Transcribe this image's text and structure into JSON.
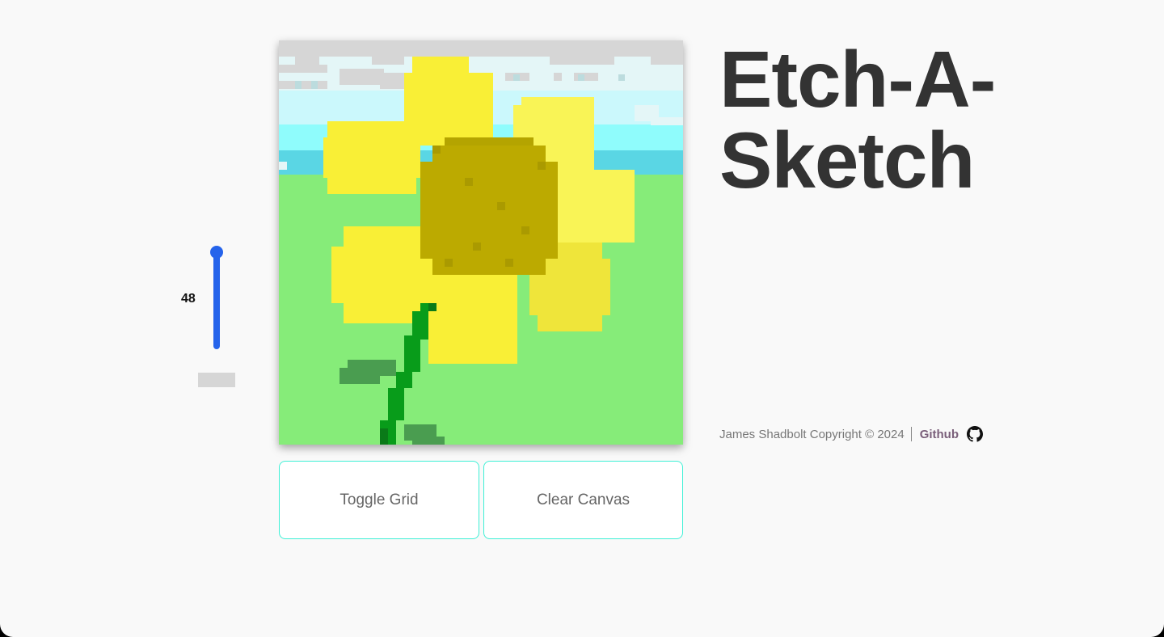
{
  "title": "Etch-A-Sketch",
  "grid_size": {
    "value": "48"
  },
  "slider": {
    "level_fraction": 1.0,
    "color": "#2563eb"
  },
  "current_color": {
    "hex": "#d6d6d6"
  },
  "buttons": {
    "toggle_grid": "Toggle Grid",
    "clear_canvas": "Clear Canvas"
  },
  "footer": {
    "copyright": "James Shadbolt Copyright © 2024",
    "github_label": "Github",
    "github_icon": "github-icon"
  },
  "colors": {
    "background": "#f9f9f9",
    "title": "#333333",
    "button_border": "#3ef0d6",
    "link": "#7a5f7a"
  }
}
